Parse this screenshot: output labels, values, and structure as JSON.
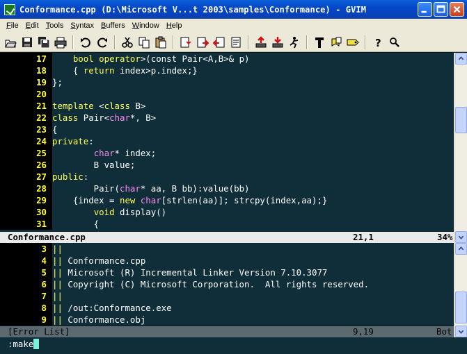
{
  "window": {
    "title": "Conformance.cpp (D:\\Microsoft V...t 2003\\samples\\Conformance) - GVIM"
  },
  "menu": [
    {
      "pre": "",
      "ul": "F",
      "post": "ile"
    },
    {
      "pre": "",
      "ul": "E",
      "post": "dit"
    },
    {
      "pre": "",
      "ul": "T",
      "post": "ools"
    },
    {
      "pre": "",
      "ul": "S",
      "post": "yntax"
    },
    {
      "pre": "",
      "ul": "B",
      "post": "uffers"
    },
    {
      "pre": "",
      "ul": "W",
      "post": "indow"
    },
    {
      "pre": "",
      "ul": "H",
      "post": "elp"
    }
  ],
  "toolbar_icons": [
    "open-icon",
    "save-icon",
    "save-all-icon",
    "print-icon",
    "undo-icon",
    "redo-icon",
    "cut-icon",
    "copy-icon",
    "paste-icon",
    "find-replace-icon",
    "find-next-icon",
    "find-prev-icon",
    "load-session-icon",
    "save-session-icon",
    "run-script-icon",
    "make-icon",
    "build-tags-icon",
    "jump-tag-icon",
    "help-icon",
    "find-help-icon"
  ],
  "editor_top": {
    "lines": [
      {
        "n": "17",
        "parts": [
          [
            "",
            "    "
          ],
          [
            "kw",
            "bool"
          ],
          [
            "",
            " "
          ],
          [
            "kw",
            "operator"
          ],
          [
            "",
            ">(const Pair<A,B>& p)"
          ]
        ]
      },
      {
        "n": "18",
        "parts": [
          [
            "",
            "    { "
          ],
          [
            "kw",
            "return"
          ],
          [
            "",
            " index>p.index;}"
          ]
        ]
      },
      {
        "n": "19",
        "parts": [
          [
            "",
            "};"
          ]
        ]
      },
      {
        "n": "20",
        "parts": [
          [
            "",
            ""
          ]
        ]
      },
      {
        "n": "21",
        "parts": [
          [
            "kw",
            "template"
          ],
          [
            "",
            " <"
          ],
          [
            "kw",
            "class"
          ],
          [
            "",
            " B>"
          ]
        ]
      },
      {
        "n": "22",
        "parts": [
          [
            "kw",
            "class"
          ],
          [
            "",
            " Pair<"
          ],
          [
            "ty",
            "char"
          ],
          [
            "",
            "*, B>"
          ]
        ]
      },
      {
        "n": "23",
        "parts": [
          [
            "",
            "{"
          ]
        ]
      },
      {
        "n": "24",
        "parts": [
          [
            "kw",
            "private"
          ],
          [
            "",
            ":"
          ]
        ]
      },
      {
        "n": "25",
        "parts": [
          [
            "",
            "        "
          ],
          [
            "ty",
            "char"
          ],
          [
            "",
            "* index;"
          ]
        ]
      },
      {
        "n": "26",
        "parts": [
          [
            "",
            "        B value;"
          ]
        ]
      },
      {
        "n": "27",
        "parts": [
          [
            "kw",
            "public"
          ],
          [
            "",
            ":"
          ]
        ]
      },
      {
        "n": "28",
        "parts": [
          [
            "",
            "        Pair("
          ],
          [
            "ty",
            "char"
          ],
          [
            "",
            "* aa, B bb):value(bb)"
          ]
        ]
      },
      {
        "n": "29",
        "parts": [
          [
            "",
            "    {index = "
          ],
          [
            "kw",
            "new"
          ],
          [
            "",
            " "
          ],
          [
            "ty",
            "char"
          ],
          [
            "",
            "[strlen(aa)]; strcpy(index,aa);}"
          ]
        ]
      },
      {
        "n": "30",
        "parts": [
          [
            "",
            "        "
          ],
          [
            "kw",
            "void"
          ],
          [
            "",
            " display()"
          ]
        ]
      },
      {
        "n": "31",
        "parts": [
          [
            "",
            "        {"
          ]
        ]
      }
    ]
  },
  "status_top": {
    "file": "Conformance.cpp",
    "pos": "21,1",
    "pct": "34%"
  },
  "editor_bottom": {
    "lines": [
      {
        "n": "3",
        "parts": [
          [
            "kw",
            "||"
          ]
        ]
      },
      {
        "n": "4",
        "parts": [
          [
            "kw",
            "||"
          ],
          [
            "",
            " Conformance.cpp"
          ]
        ]
      },
      {
        "n": "5",
        "parts": [
          [
            "kw",
            "||"
          ],
          [
            "",
            " Microsoft (R) Incremental Linker Version 7.10.3077"
          ]
        ]
      },
      {
        "n": "6",
        "parts": [
          [
            "kw",
            "||"
          ],
          [
            "",
            " Copyright (C) Microsoft Corporation.  All rights reserved."
          ]
        ]
      },
      {
        "n": "7",
        "parts": [
          [
            "kw",
            "||"
          ]
        ]
      },
      {
        "n": "8",
        "parts": [
          [
            "kw",
            "||"
          ],
          [
            "",
            " /out:Conformance.exe"
          ]
        ]
      },
      {
        "n": "9",
        "parts": [
          [
            "kw",
            "||"
          ],
          [
            "",
            " Conformance.obj"
          ]
        ]
      }
    ]
  },
  "status_bottom": {
    "file": "[Error List]",
    "pos": "9,19",
    "pct": "Bot"
  },
  "cmdline": {
    "text": ":make"
  }
}
